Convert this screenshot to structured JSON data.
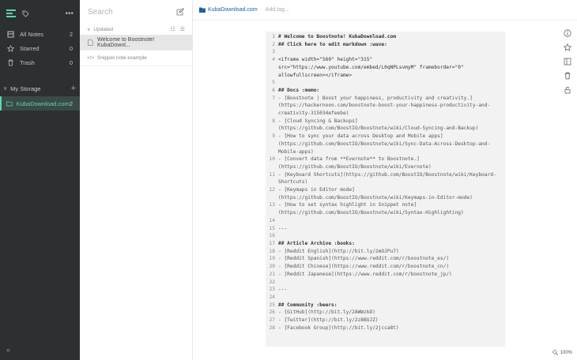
{
  "sidebar": {
    "items": [
      {
        "label": "All Notes",
        "count": "2",
        "icon": "all-notes-icon"
      },
      {
        "label": "Starred",
        "count": "0",
        "icon": "star-icon"
      },
      {
        "label": "Trash",
        "count": "0",
        "icon": "trash-icon"
      }
    ],
    "storage_label": "My Storage",
    "folder": {
      "label": "KubaDownload.com",
      "count": "2"
    },
    "collapse": "«"
  },
  "notelist": {
    "search_placeholder": "Search",
    "sort_label": "Updated",
    "notes": [
      {
        "title": "Welcome to Boostnote! KubaDownl...",
        "type": "markdown"
      },
      {
        "title": "Snippet note example",
        "type": "snippet"
      }
    ]
  },
  "topbar": {
    "folder": "KubaDownload.com",
    "add_tag": "Add tag..."
  },
  "editor": {
    "lines": [
      {
        "n": "1",
        "t": "# Welcome to Boostnote! KubaDownload.com"
      },
      {
        "n": "2",
        "t": "## Click here to edit markdown :wave:"
      },
      {
        "n": "3",
        "t": ""
      },
      {
        "n": "4",
        "t": "<iframe width=\"560\" height=\"315\" src=\"https://www.youtube.com/embed/L0qNPLsvmyM\" frameborder=\"0\" allowfullscreen></iframe>"
      },
      {
        "n": "5",
        "t": ""
      },
      {
        "n": "6",
        "t": "## Docs :memo:"
      },
      {
        "n": "7",
        "t": "- [Boostnote | Boost your happiness, productivity and creativity.](https://hackernoon.com/boostnote-boost-your-happiness-productivity-and-creativity-315034efeebe)"
      },
      {
        "n": "8",
        "t": "- [Cloud Syncing & Backups](https://github.com/BoostIO/Boostnote/wiki/Cloud-Syncing-and-Backup)"
      },
      {
        "n": "9",
        "t": "- [How to sync your data across Desktop and Mobile apps](https://github.com/BoostIO/Boostnote/wiki/Sync-Data-Across-Desktop-and-Mobile-apps)"
      },
      {
        "n": "10",
        "t": "- [Convert data from **Evernote** to Boostnote.](https://github.com/BoostIO/Boostnote/wiki/Evernote)"
      },
      {
        "n": "11",
        "t": "- [Keyboard Shortcuts](https://github.com/BoostIO/Boostnote/wiki/Keyboard-Shortcuts)"
      },
      {
        "n": "12",
        "t": "- [Keymaps in Editor mode](https://github.com/BoostIO/Boostnote/wiki/Keymaps-in-Editor-mode)"
      },
      {
        "n": "13",
        "t": "- [How to set syntax highlight in Snippet note](https://github.com/BoostIO/Boostnote/wiki/Syntax-Highlighting)"
      },
      {
        "n": "14",
        "t": ""
      },
      {
        "n": "15",
        "t": "---"
      },
      {
        "n": "16",
        "t": ""
      },
      {
        "n": "17",
        "t": "## Article Archive :books:"
      },
      {
        "n": "18",
        "t": "- [Reddit English](http://bit.ly/2mOJPu7)"
      },
      {
        "n": "19",
        "t": "- [Reddit Spanish](https://www.reddit.com/r/boostnote_es/)"
      },
      {
        "n": "20",
        "t": "- [Reddit Chinese](https://www.reddit.com/r/boostnote_cn/)"
      },
      {
        "n": "21",
        "t": "- [Reddit Japanese](https://www.reddit.com/r/boostnote_jp/)"
      },
      {
        "n": "22",
        "t": ""
      },
      {
        "n": "23",
        "t": "---"
      },
      {
        "n": "24",
        "t": ""
      },
      {
        "n": "25",
        "t": "## Community :beers:"
      },
      {
        "n": "26",
        "t": "- [GitHub](http://bit.ly/2AWWzkD)"
      },
      {
        "n": "27",
        "t": "- [Twitter](http://bit.ly/2z8BUJZ)"
      },
      {
        "n": "28",
        "t": "- [Facebook Group](http://bit.ly/2jcca8t)"
      }
    ]
  },
  "zoom": "100%",
  "colors": {
    "accent": "#5ed6a8",
    "sidebar_bg": "#2c3033",
    "link": "#1f5fa8"
  }
}
